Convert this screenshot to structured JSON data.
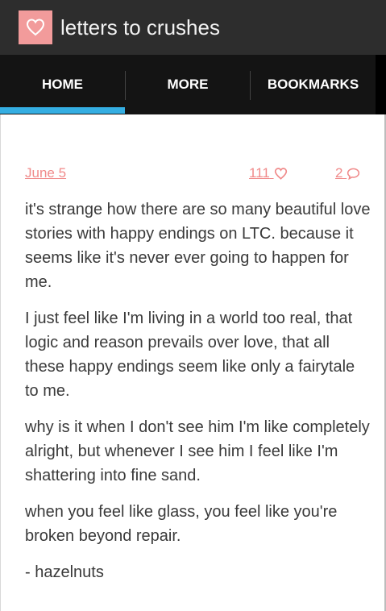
{
  "app": {
    "title": "letters to crushes",
    "logo_icon": "heart-icon",
    "logo_color": "#f29b9b"
  },
  "tabs": [
    {
      "label": "HOME",
      "active": true
    },
    {
      "label": "MORE",
      "active": false
    },
    {
      "label": "BOOKMARKS",
      "active": false
    }
  ],
  "colors": {
    "accent": "#35aee2",
    "meta": "#f08a8a",
    "toolbar": "#2d2d2d",
    "tabbar": "#141414"
  },
  "post": {
    "date": "June 5",
    "likes": "111",
    "comments": "2",
    "paragraphs": [
      "it's strange how there are so many beautiful love stories with happy endings on LTC. because it seems like it's never ever going to happen for me.",
      "I just feel like I'm living in a world too real, that logic and reason prevails over love, that all these happy endings seem like only a fairytale to me.",
      "why is it when I don't see him I'm like completely alright, but whenever I see him I feel like I'm shattering into fine sand.",
      "when you feel like glass, you feel like you're broken beyond repair.",
      "- hazelnuts"
    ]
  }
}
